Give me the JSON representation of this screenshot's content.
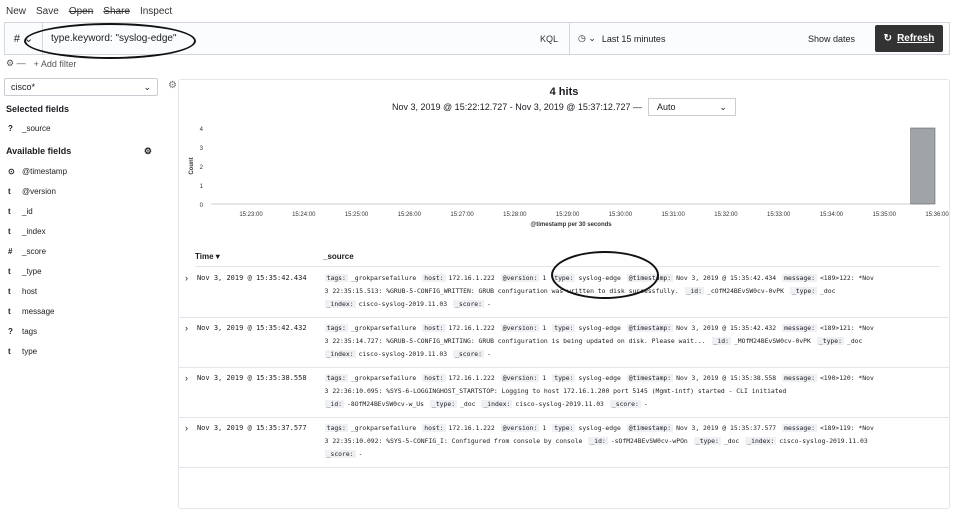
{
  "top_menu": [
    "New",
    "Save",
    "Open",
    "Share",
    "Inspect"
  ],
  "query": {
    "language_icon": "#",
    "text": "type.keyword: \"syslog-edge\"",
    "kql": "KQL",
    "time_range": "Last 15 minutes",
    "show_dates": "Show dates",
    "refresh": "Refresh"
  },
  "filter": {
    "add": "+ Add filter"
  },
  "sidebar": {
    "index_pattern": "cisco*",
    "selected_title": "Selected fields",
    "selected": [
      {
        "type": "?",
        "name": "_source"
      }
    ],
    "available_title": "Available fields",
    "available": [
      {
        "type": "⊙",
        "name": "@timestamp"
      },
      {
        "type": "t",
        "name": "@version"
      },
      {
        "type": "t",
        "name": "_id"
      },
      {
        "type": "t",
        "name": "_index"
      },
      {
        "type": "#",
        "name": "_score"
      },
      {
        "type": "t",
        "name": "_type"
      },
      {
        "type": "t",
        "name": "host"
      },
      {
        "type": "t",
        "name": "message"
      },
      {
        "type": "?",
        "name": "tags"
      },
      {
        "type": "t",
        "name": "type"
      }
    ]
  },
  "main": {
    "hits": "4 hits",
    "range": "Nov 3, 2019 @ 15:22:12.727 - Nov 3, 2019 @ 15:37:12.727 —",
    "interval": "Auto",
    "col_time": "Time ▾",
    "col_source": "_source"
  },
  "chart_data": {
    "type": "bar",
    "ylabel": "Count",
    "xlabel": "@timestamp per 30 seconds",
    "ylim": [
      0,
      4
    ],
    "yticks": [
      "0",
      "1",
      "2",
      "3",
      "4"
    ],
    "xticks": [
      "15:23:00",
      "15:24:00",
      "15:25:00",
      "15:26:00",
      "15:27:00",
      "15:28:00",
      "15:29:00",
      "15:30:00",
      "15:31:00",
      "15:32:00",
      "15:33:00",
      "15:34:00",
      "15:35:00",
      "15:36:00"
    ],
    "categories": [
      "15:35:30"
    ],
    "values": [
      4
    ],
    "bar_color": "#a0a3a8"
  },
  "rows": [
    {
      "time": "Nov 3, 2019 @ 15:35:42.434",
      "lines": [
        [
          [
            "tags:",
            "_grokparsefailure"
          ],
          [
            "host:",
            "172.16.1.222"
          ],
          [
            "@version:",
            "1"
          ],
          [
            "type:",
            "syslog-edge"
          ],
          [
            "@timestamp:",
            "Nov 3, 2019 @ 15:35:42.434"
          ],
          [
            "message:",
            "<189>122: *Nov"
          ]
        ],
        [
          [
            "",
            "3 22:35:15.513: %GRUB-5-CONFIG_WRITTEN: GRUB configuration was written to disk successfully."
          ],
          [
            "_id:",
            "_cOfM24BEvSW0cv-0vPK"
          ],
          [
            "_type:",
            "_doc"
          ]
        ],
        [
          [
            "_index:",
            "cisco-syslog-2019.11.03"
          ],
          [
            "_score:",
            "-"
          ]
        ]
      ]
    },
    {
      "time": "Nov 3, 2019 @ 15:35:42.432",
      "lines": [
        [
          [
            "tags:",
            "_grokparsefailure"
          ],
          [
            "host:",
            "172.16.1.222"
          ],
          [
            "@version:",
            "1"
          ],
          [
            "type:",
            "syslog-edge"
          ],
          [
            "@timestamp:",
            "Nov 3, 2019 @ 15:35:42.432"
          ],
          [
            "message:",
            "<189>121: *Nov"
          ]
        ],
        [
          [
            "",
            "3 22:35:14.727: %GRUB-5-CONFIG_WRITING: GRUB configuration is being updated on disk. Please wait..."
          ],
          [
            "_id:",
            "_MOfM24BEvSW0cv-0vPK"
          ],
          [
            "_type:",
            "_doc"
          ]
        ],
        [
          [
            "_index:",
            "cisco-syslog-2019.11.03"
          ],
          [
            "_score:",
            "-"
          ]
        ]
      ]
    },
    {
      "time": "Nov 3, 2019 @ 15:35:38.558",
      "lines": [
        [
          [
            "tags:",
            "_grokparsefailure"
          ],
          [
            "host:",
            "172.16.1.222"
          ],
          [
            "@version:",
            "1"
          ],
          [
            "type:",
            "syslog-edge"
          ],
          [
            "@timestamp:",
            "Nov 3, 2019 @ 15:35:38.558"
          ],
          [
            "message:",
            "<190>120: *Nov"
          ]
        ],
        [
          [
            "",
            "3 22:36:10.095: %SYS-6-LOGGINGHOST_STARTSTOP: Logging to host 172.16.1.200 port 5145 (Mgmt-intf) started - CLI initiated"
          ]
        ],
        [
          [
            "_id:",
            "-8OfM24BEvSW0cv-w_Us"
          ],
          [
            "_type:",
            "_doc"
          ],
          [
            "_index:",
            "cisco-syslog-2019.11.03"
          ],
          [
            "_score:",
            "-"
          ]
        ]
      ]
    },
    {
      "time": "Nov 3, 2019 @ 15:35:37.577",
      "lines": [
        [
          [
            "tags:",
            "_grokparsefailure"
          ],
          [
            "host:",
            "172.16.1.222"
          ],
          [
            "@version:",
            "1"
          ],
          [
            "type:",
            "syslog-edge"
          ],
          [
            "@timestamp:",
            "Nov 3, 2019 @ 15:35:37.577"
          ],
          [
            "message:",
            "<189>119: *Nov"
          ]
        ],
        [
          [
            "",
            "3 22:35:10.092: %SYS-5-CONFIG_I: Configured from console by console"
          ],
          [
            "_id:",
            "-sOfM24BEvSW0cv-wPOn"
          ],
          [
            "_type:",
            "_doc"
          ],
          [
            "_index:",
            "cisco-syslog-2019.11.03"
          ]
        ],
        [
          [
            "_score:",
            "-"
          ]
        ]
      ]
    }
  ]
}
